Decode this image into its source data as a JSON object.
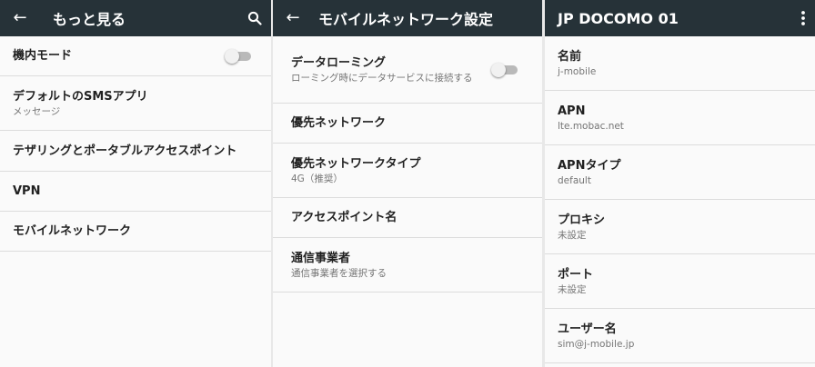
{
  "panel1": {
    "title": "もっと見る",
    "items": [
      {
        "title": "機内モード",
        "toggle": "off"
      },
      {
        "title": "デフォルトのSMSアプリ",
        "subtitle": "メッセージ"
      },
      {
        "title": "テザリングとポータブルアクセスポイント"
      },
      {
        "title": "VPN"
      },
      {
        "title": "モバイルネットワーク"
      }
    ]
  },
  "panel2": {
    "title": "モバイルネットワーク設定",
    "items": [
      {
        "title": "データローミング",
        "subtitle": "ローミング時にデータサービスに接続する",
        "toggle": "off"
      },
      {
        "title": "優先ネットワーク"
      },
      {
        "title": "優先ネットワークタイプ",
        "subtitle": "4G（推奨）"
      },
      {
        "title": "アクセスポイント名"
      },
      {
        "title": "通信事業者",
        "subtitle": "通信事業者を選択する"
      }
    ]
  },
  "panel3": {
    "title": "JP DOCOMO 01",
    "items": [
      {
        "title": "名前",
        "subtitle": "j-mobile"
      },
      {
        "title": "APN",
        "subtitle": "lte.mobac.net"
      },
      {
        "title": "APNタイプ",
        "subtitle": "default"
      },
      {
        "title": "プロキシ",
        "subtitle": "未設定"
      },
      {
        "title": "ポート",
        "subtitle": "未設定"
      },
      {
        "title": "ユーザー名",
        "subtitle": "sim@j-mobile.jp"
      }
    ]
  },
  "icons": {
    "back": "arrow-left-icon",
    "search": "search-icon",
    "overflow": "more-vert-icon"
  },
  "colors": {
    "appbar": "#263238",
    "background": "#fafafa",
    "switch_track_off": "#b9b9b9"
  }
}
